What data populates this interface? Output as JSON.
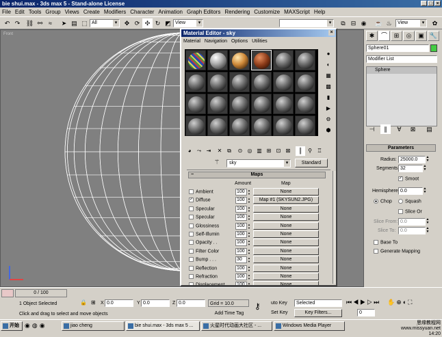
{
  "app": {
    "title": "bie shui.max - 3ds max 5 - Stand-alone License"
  },
  "menu": [
    "File",
    "Edit",
    "Tools",
    "Group",
    "Views",
    "Create",
    "Modifiers",
    "Character",
    "Animation",
    "Graph Editors",
    "Rendering",
    "Customize",
    "MAXScript",
    "Help"
  ],
  "toolbar": {
    "filter_value": "All",
    "view_value": "View",
    "view_value2": "View"
  },
  "viewport": {
    "label": "Front"
  },
  "material_editor": {
    "title": "Material Editor - sky",
    "menu": [
      "Material",
      "Navigation",
      "Options",
      "Utilities"
    ],
    "material_name": "sky",
    "material_type": "Standard",
    "maps_title": "Maps",
    "col_amount": "Amount",
    "col_map": "Map",
    "maps": [
      {
        "name": "Ambient",
        "checked": false,
        "amount": "100",
        "map": "None"
      },
      {
        "name": "Diffuse",
        "checked": true,
        "amount": "100",
        "map": "Map #1 (SKYSUN2.JPG)"
      },
      {
        "name": "Specular",
        "checked": false,
        "amount": "100",
        "map": "None"
      },
      {
        "name": "Specular",
        "checked": false,
        "amount": "100",
        "map": "None"
      },
      {
        "name": "Glossiness",
        "checked": false,
        "amount": "100",
        "map": "None"
      },
      {
        "name": "Self-Illumin",
        "checked": false,
        "amount": "100",
        "map": "None"
      },
      {
        "name": "Opacity . .",
        "checked": false,
        "amount": "100",
        "map": "None"
      },
      {
        "name": "Filter Color",
        "checked": false,
        "amount": "100",
        "map": "None"
      },
      {
        "name": "Bump . . .",
        "checked": false,
        "amount": "30",
        "map": "None"
      },
      {
        "name": "Reflection",
        "checked": false,
        "amount": "100",
        "map": "None"
      },
      {
        "name": "Refraction",
        "checked": false,
        "amount": "100",
        "map": "None"
      },
      {
        "name": "Displacement",
        "checked": false,
        "amount": "100",
        "map": "None"
      }
    ]
  },
  "command_panel": {
    "object_name": "Sphere01",
    "object_color": "#44cc44",
    "modifier_list": "Modifier List",
    "stack_item": "Sphere",
    "params_title": "Parameters",
    "radius_label": "Radius:",
    "radius_value": "25000.0",
    "segments_label": "Segments:",
    "segments_value": "32",
    "smooth_label": "Smoot",
    "hemisphere_label": "Hemisphere:",
    "hemisphere_value": "0.0",
    "chop_label": "Chop",
    "squash_label": "Squash",
    "slice_on_label": "Slice Or",
    "slice_from_label": "Slice From:",
    "slice_from_value": "0.0",
    "slice_to_label": "Slice To:",
    "slice_to_value": "0.0",
    "base_to_label": "Base To",
    "gen_mapping_label": "Generate Mapping"
  },
  "status": {
    "frame": "0 / 100",
    "selection": "1 Object Selected",
    "x_label": "X",
    "x_value": "0.0",
    "y_label": "Y",
    "y_value": "0.0",
    "z_label": "Z",
    "z_value": "0.0",
    "grid": "Grid = 10.0",
    "auto_key": "uto Key",
    "set_key": "Set Key",
    "key_mode": "Selected",
    "key_filters": "Key Filters...",
    "frame_num": "0",
    "prompt": "Click and drag to select and move objects",
    "add_time_tag": "Add Time Tag"
  },
  "taskbar": {
    "start": "开始",
    "tasks": [
      "jiao cheng",
      "bie shui.max - 3ds max 5 ...",
      "火星时代动画大社区 - ...",
      "Windows Media Player"
    ],
    "time": "14:20",
    "watermark": "思缘教程网 www.missyuan.net"
  },
  "colors": {
    "title_blue": "#0a246a",
    "viewport_bg": "#808080",
    "wire": "#ffffff"
  }
}
